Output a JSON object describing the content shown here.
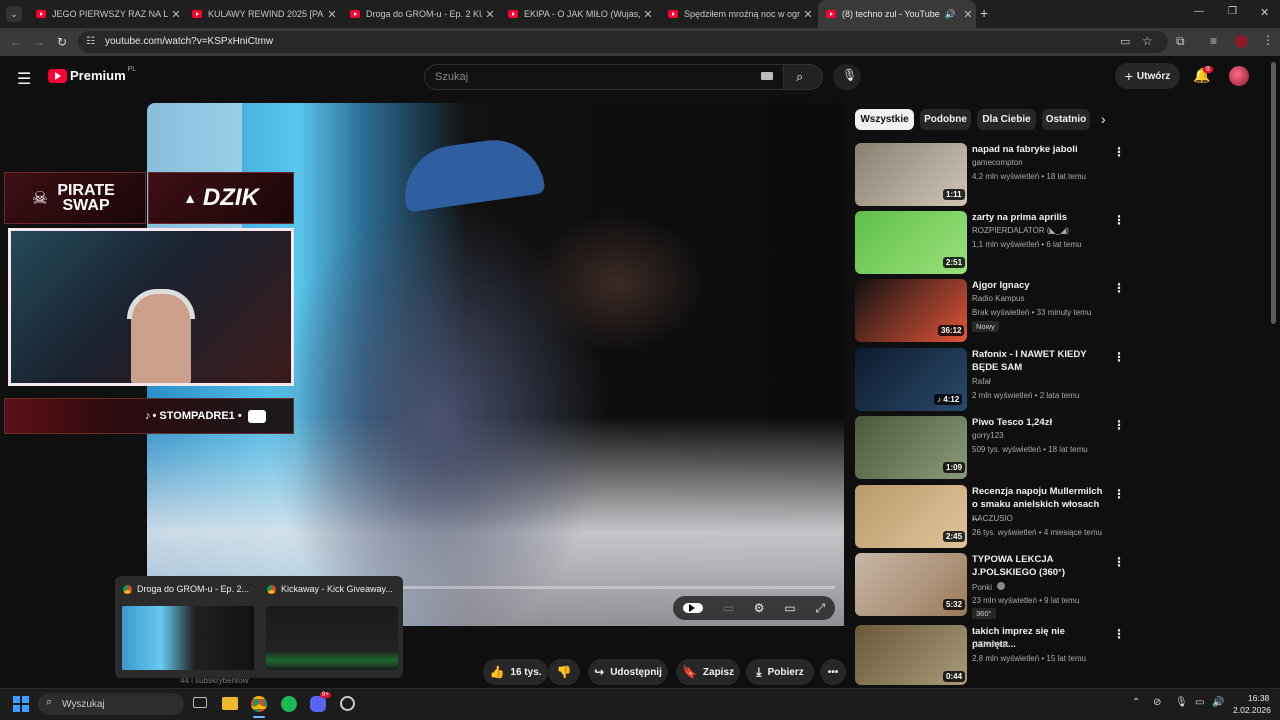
{
  "browser": {
    "tabs": [
      {
        "title": "JEGO PIERWSZY RAZ NA LODZI"
      },
      {
        "title": "KULAWY REWIND 2025 [PART"
      },
      {
        "title": "Droga do GROM-u - Ep. 2 KUR"
      },
      {
        "title": "EKIPA - O JAK MIŁO (Wujas, Ma"
      },
      {
        "title": "Spędziłem mroźną noc w ogro"
      },
      {
        "title": "(8) techno zul - YouTube"
      }
    ],
    "url": "youtube.com/watch?v=KSPxHniCtmw"
  },
  "header": {
    "logo": "Premium",
    "region": "PL",
    "search_placeholder": "Szukaj",
    "create_label": "Utwórz",
    "notifications_count": "8"
  },
  "video": {
    "overlay": {
      "sponsor_left": "PIRATE SWAP",
      "sponsor_right": "DZIK",
      "socials_text": "• STOMPADRE1 •"
    }
  },
  "actions": {
    "like_count": "16 tys.",
    "share_label": "Udostępnij",
    "save_label": "Zapisz",
    "download_label": "Pobierz"
  },
  "channel_subs_hint": "44 l subskrybentów",
  "chips": [
    "Wszystkie",
    "Podobne",
    "Dla Ciebie",
    "Ostatnio"
  ],
  "recommendations": [
    {
      "title": "napad na fabryke jaboli",
      "channel": "gamecompton",
      "meta": "4,2 mln wyświetleń • 18 lat temu",
      "duration": "1:11",
      "colors": [
        "#8a8070",
        "#cfc6b8"
      ]
    },
    {
      "title": "zarty na prima aprilis",
      "channel": "ROZPIERDALATOR (◣_◢)",
      "meta": "1,1 mln wyświetleń • 6 lat temu",
      "duration": "2:51",
      "colors": [
        "#5fbf4a",
        "#9be07a"
      ]
    },
    {
      "title": "Ajgor Ignacy",
      "channel": "Radio Kampus",
      "meta": "Brak wyświetleń • 33 minuty temu",
      "duration": "36:12",
      "badge": "Nowy",
      "colors": [
        "#111111",
        "#e2553a"
      ]
    },
    {
      "title": "Rafonix - I NAWET KIEDY BĘDE SAM",
      "channel": "Rafał",
      "meta": "2 mln wyświetleń • 2 lata temu",
      "duration": "♪ 4:12",
      "colors": [
        "#0d1a2e",
        "#2a4a6a"
      ]
    },
    {
      "title": "Piwo Tesco 1,24zł",
      "channel": "gorry123",
      "meta": "509 tys. wyświetleń • 18 lat temu",
      "duration": "1:09",
      "colors": [
        "#4a5a3a",
        "#8a9a7a"
      ]
    },
    {
      "title": "Recenzja napoju Mullermilch o smaku anielskich włosach ...",
      "channel": "KACZUSIO",
      "meta": "26 tys. wyświetleń • 4 miesiące temu",
      "duration": "2:45",
      "colors": [
        "#b99a6a",
        "#e0c59a"
      ]
    },
    {
      "title": "TYPOWA LEKCJA J.POLSKIEGO (360°)",
      "channel": "Ponki",
      "meta": "23 mln wyświetleń • 9 lat temu",
      "duration": "5:32",
      "badge": "360°",
      "colors": [
        "#c8b8a8",
        "#9a7a5a"
      ]
    },
    {
      "title": "takich imprez się nie pamięta...",
      "channel": "GTNeVeR",
      "meta": "2,8 mln wyświetleń • 15 lat temu",
      "duration": "0:44",
      "colors": [
        "#6a5a3a",
        "#a89a7a"
      ]
    }
  ],
  "taskbar_previews": [
    {
      "title": "Droga do GROM-u - Ep. 2..."
    },
    {
      "title": "Kickaway - Kick Giveaway..."
    }
  ],
  "taskbar": {
    "search_label": "Wyszukaj",
    "time": "16:38",
    "date": "2.02.2026",
    "discord_badge": "9+"
  }
}
